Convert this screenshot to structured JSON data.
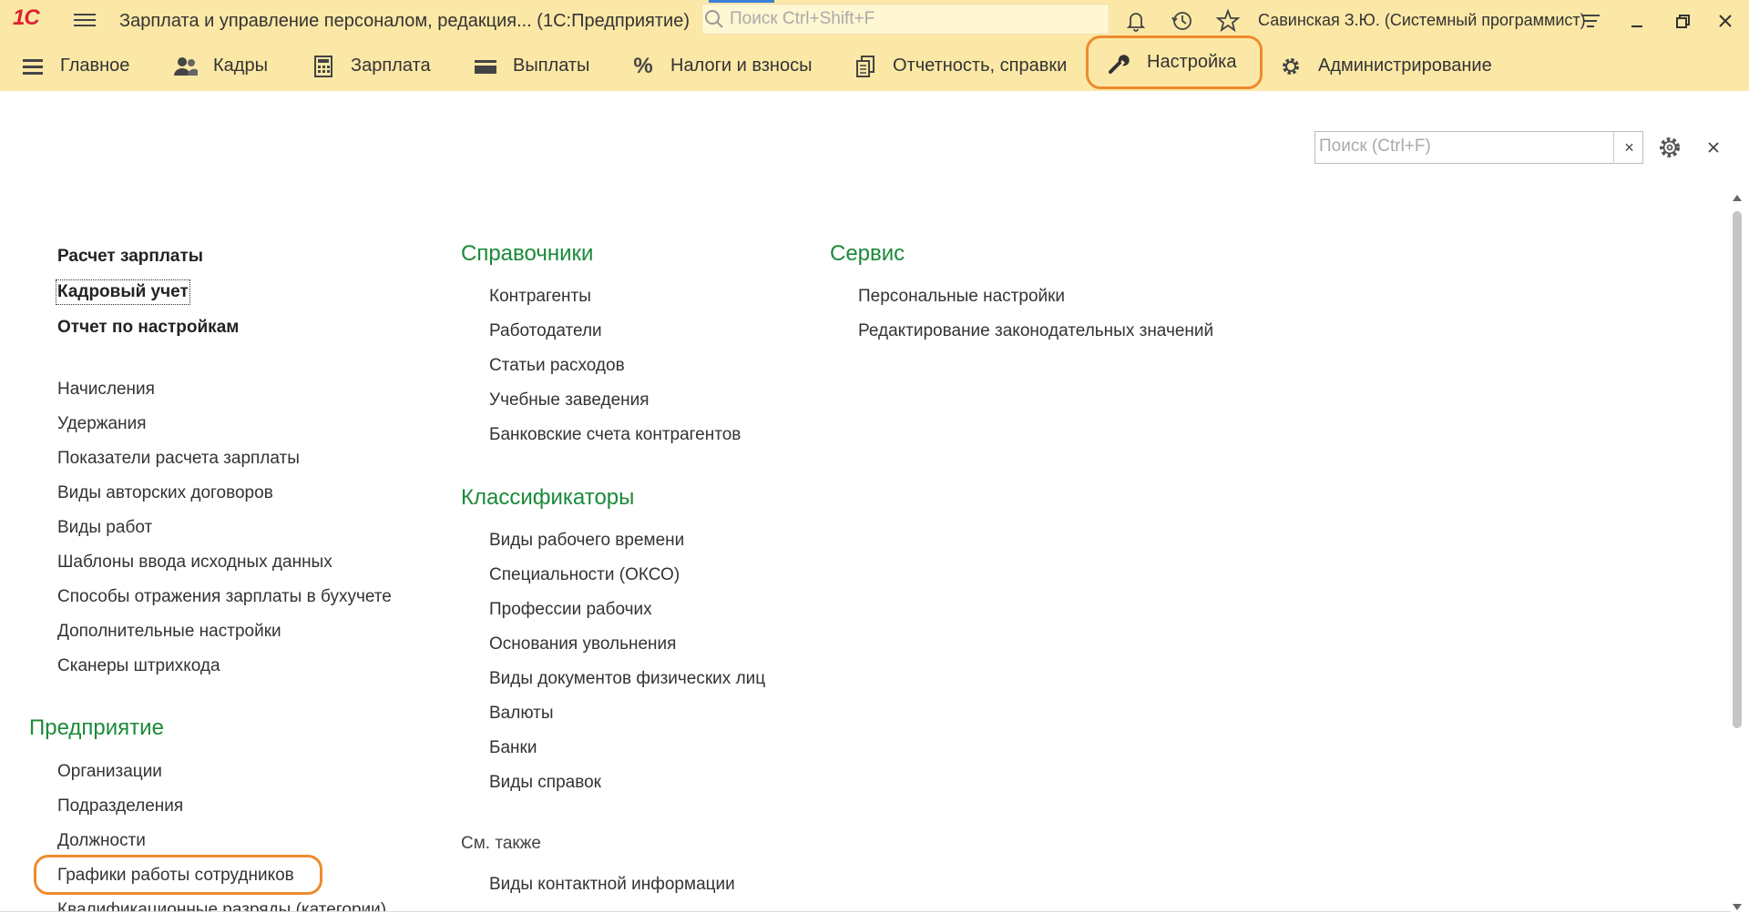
{
  "titlebar": {
    "logo": "1С",
    "app_title": "Зарплата и управление персоналом, редакция...  (1С:Предприятие)",
    "search_placeholder": "Поиск Ctrl+Shift+F",
    "user": "Савинская З.Ю. (Системный программист)",
    "icons": [
      "menu-icon",
      "bell-icon",
      "history-icon",
      "star-icon",
      "settings-lines-icon",
      "minimize-icon",
      "restore-icon",
      "close-icon"
    ]
  },
  "menu": {
    "items": [
      {
        "label": "Главное",
        "icon": "hamburger-icon"
      },
      {
        "label": "Кадры",
        "icon": "people-icon"
      },
      {
        "label": "Зарплата",
        "icon": "calculator-icon"
      },
      {
        "label": "Выплаты",
        "icon": "wallet-icon"
      },
      {
        "label": "Налоги и взносы",
        "icon": "percent-icon"
      },
      {
        "label": "Отчетность, справки",
        "icon": "documents-icon"
      },
      {
        "label": "Настройка",
        "icon": "wrench-icon",
        "active": true
      },
      {
        "label": "Администрирование",
        "icon": "gear-icon"
      }
    ]
  },
  "panel": {
    "search_placeholder": "Поиск (Ctrl+F)",
    "clear": "×",
    "close": "×"
  },
  "column1": {
    "bold_links": [
      "Расчет зарплаты",
      "Кадровый учет",
      "Отчет по настройкам"
    ],
    "links": [
      "Начисления",
      "Удержания",
      "Показатели расчета зарплаты",
      "Виды авторских договоров",
      "Виды работ",
      "Шаблоны ввода исходных данных",
      "Способы отражения зарплаты в бухучете",
      "Дополнительные настройки",
      "Сканеры штрихкода"
    ],
    "enterprise_heading": "Предприятие",
    "enterprise_links": [
      "Организации",
      "Подразделения",
      "Должности",
      "Графики работы сотрудников",
      "Квалификационные разряды (категории)"
    ]
  },
  "column2": {
    "references_heading": "Справочники",
    "references_links": [
      "Контрагенты",
      "Работодатели",
      "Статьи расходов",
      "Учебные заведения",
      "Банковские счета контрагентов"
    ],
    "classifiers_heading": "Классификаторы",
    "classifiers_links": [
      "Виды рабочего времени",
      "Специальности (ОКСО)",
      "Профессии рабочих",
      "Основания увольнения",
      "Виды документов физических лиц",
      "Валюты",
      "Банки",
      "Виды справок"
    ],
    "see_also_heading": "См. также",
    "see_also_links": [
      "Виды контактной информации"
    ]
  },
  "column3": {
    "service_heading": "Сервис",
    "service_links": [
      "Персональные настройки",
      "Редактирование законодательных значений"
    ]
  },
  "colors": {
    "toolbar_bg": "#fbe8a6",
    "section_heading": "#1a8a3a",
    "highlight": "#ef8a2e"
  }
}
